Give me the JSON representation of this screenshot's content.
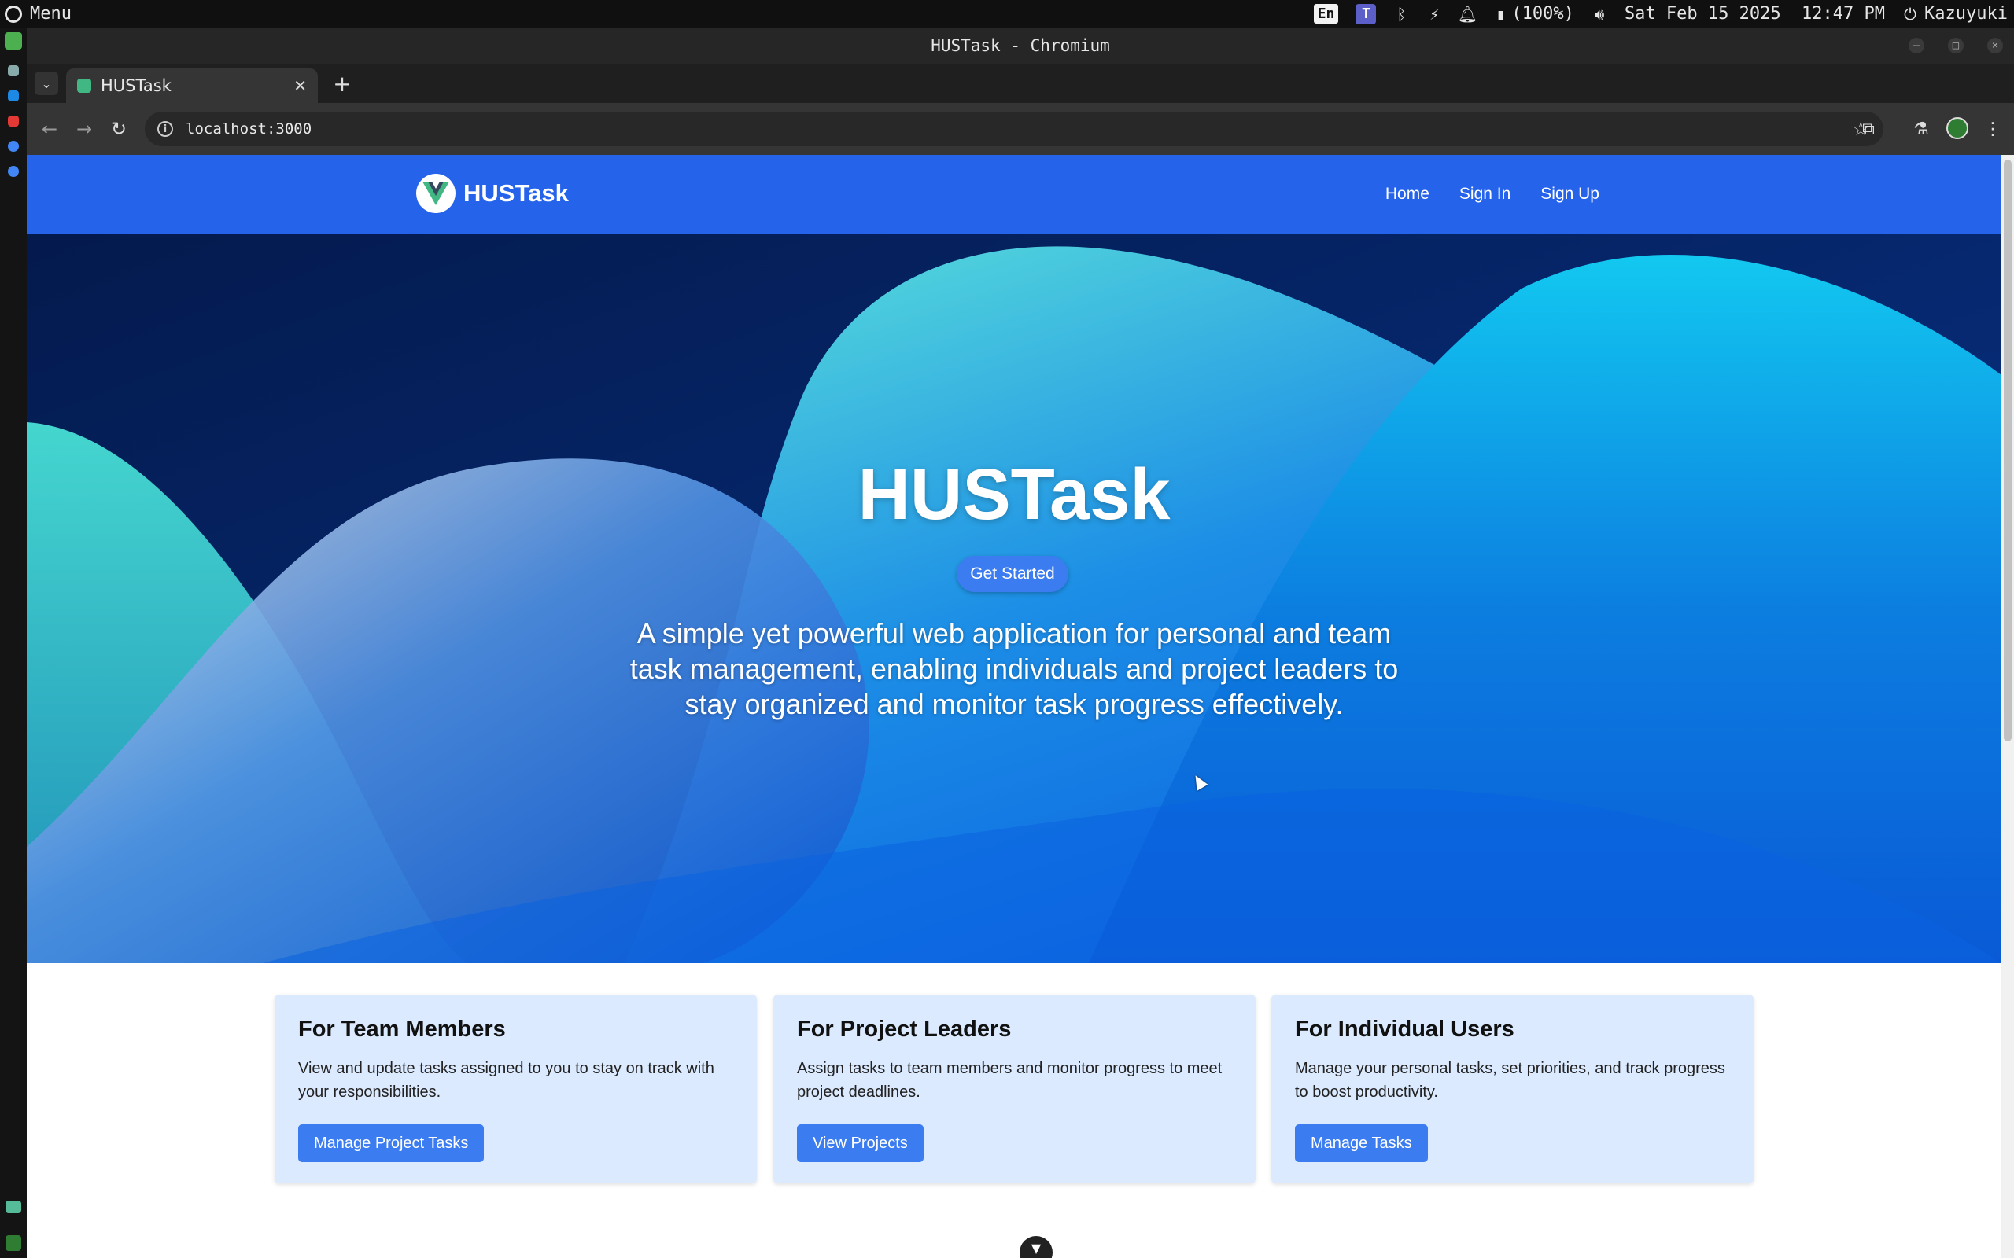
{
  "os": {
    "menu_label": "Menu",
    "lang": "En",
    "teams_label": "T",
    "battery": "(100%)",
    "datetime": "Sat Feb 15 2025  12:47 PM",
    "user": "Kazuyuki"
  },
  "window": {
    "title": "HUSTask - Chromium"
  },
  "browser": {
    "tab_title": "HUSTask",
    "url": "localhost:3000"
  },
  "site": {
    "brand": "HUSTask",
    "nav": [
      "Home",
      "Sign In",
      "Sign Up"
    ],
    "hero_title": "HUSTask",
    "cta": "Get Started",
    "hero_description": "A simple yet powerful web application for personal and team task management, enabling individuals and project leaders to stay organized and monitor task progress effectively.",
    "cards": [
      {
        "title": "For Team Members",
        "text": "View and update tasks assigned to you to stay on track with your responsibilities.",
        "button": "Manage Project Tasks"
      },
      {
        "title": "For Project Leaders",
        "text": "Assign tasks to team members and monitor progress to meet project deadlines.",
        "button": "View Projects"
      },
      {
        "title": "For Individual Users",
        "text": "Manage your personal tasks, set priorities, and track progress to boost productivity.",
        "button": "Manage Tasks"
      }
    ]
  },
  "colors": {
    "nav_blue": "#2563eb",
    "button_blue": "#3b7cf0",
    "card_bg": "#dbeafe"
  }
}
